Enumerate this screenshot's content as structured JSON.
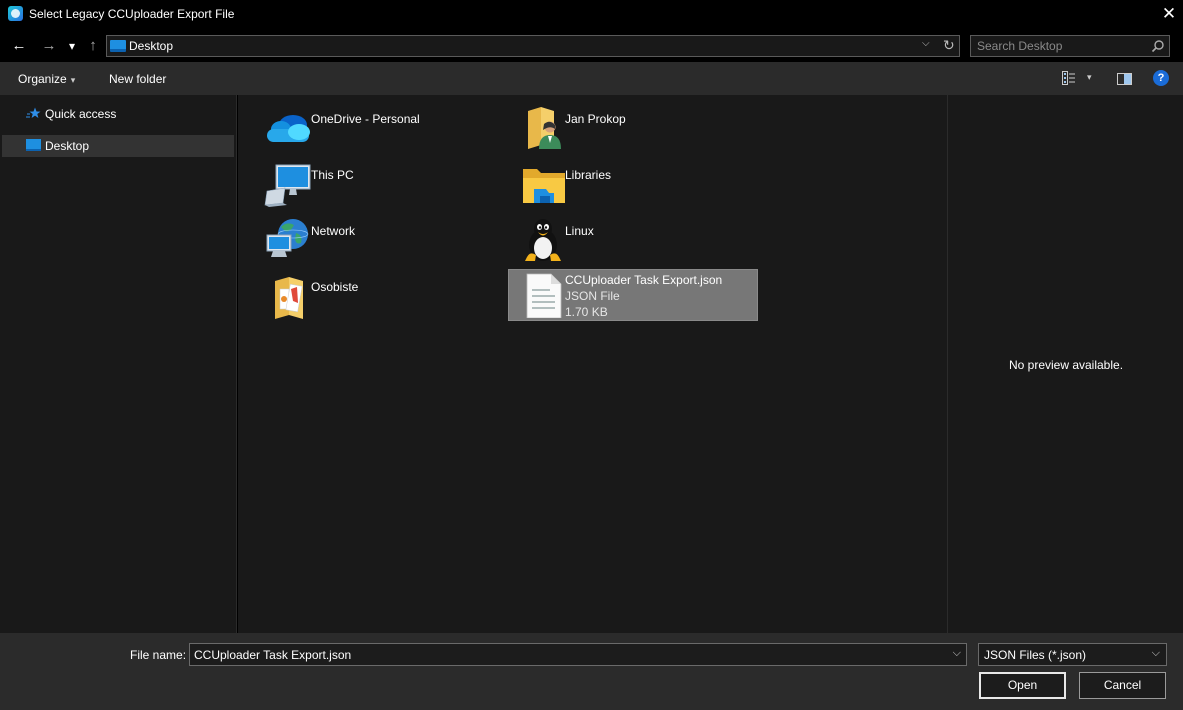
{
  "window": {
    "title": "Select Legacy CCUploader Export File",
    "close_glyph": "✕"
  },
  "nav": {
    "back_glyph": "←",
    "forward_glyph": "→",
    "recent_glyph": "▾",
    "up_glyph": "↑",
    "address": "Desktop",
    "address_dropdown_glyph": "⌵",
    "refresh_glyph": "↻",
    "search_placeholder": "Search Desktop"
  },
  "toolbar": {
    "organize": "Organize",
    "organize_caret": "▾",
    "new_folder": "New folder",
    "view_caret": "▾",
    "help_glyph": "?"
  },
  "sidebar": {
    "items": [
      {
        "label": "Quick access",
        "icon": "star-icon"
      },
      {
        "label": "Desktop",
        "icon": "desktop-icon",
        "selected": true
      }
    ]
  },
  "content": {
    "items": [
      {
        "name": "OneDrive - Personal",
        "icon": "onedrive-icon"
      },
      {
        "name": "Jan Prokop",
        "icon": "user-folder-icon"
      },
      {
        "name": "This PC",
        "icon": "this-pc-icon"
      },
      {
        "name": "Libraries",
        "icon": "libraries-icon"
      },
      {
        "name": "Network",
        "icon": "network-icon"
      },
      {
        "name": "Linux",
        "icon": "linux-icon"
      },
      {
        "name": "Osobiste",
        "icon": "folder-icon"
      },
      {
        "name": "CCUploader Task Export.json",
        "type": "JSON File",
        "size": "1.70 KB",
        "icon": "json-file-icon",
        "selected": true
      }
    ]
  },
  "preview": {
    "text": "No preview available."
  },
  "footer": {
    "file_name_label": "File name:",
    "file_name_value": "CCUploader Task Export.json",
    "file_type": "JSON Files (*.json)",
    "dropdown_glyph": "⌵",
    "open_label": "Open",
    "cancel_label": "Cancel"
  },
  "colors": {
    "accent": "#1a6cd8",
    "background": "#191919",
    "toolbar": "#2b2b2b",
    "selection": "#777777"
  }
}
